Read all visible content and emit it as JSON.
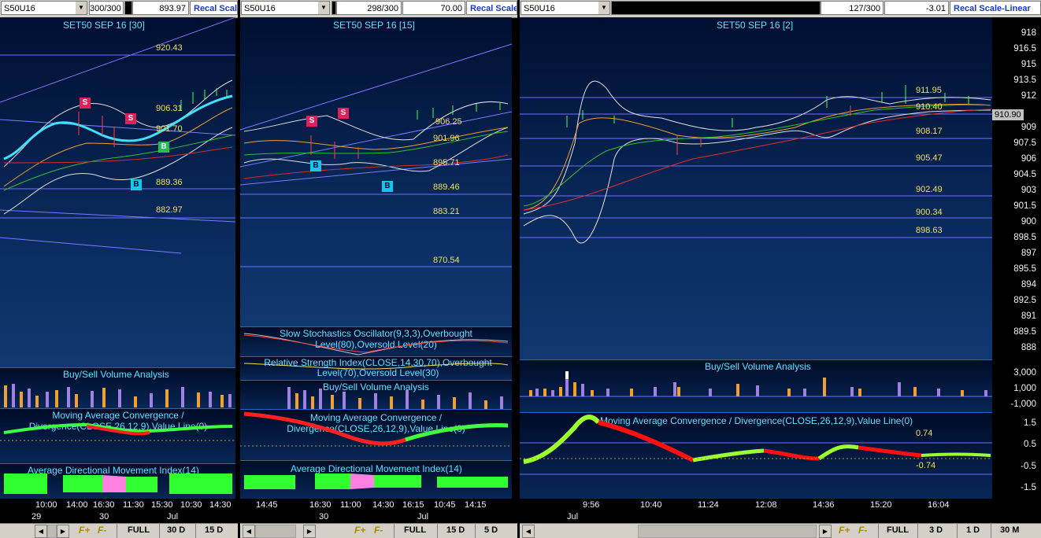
{
  "panes": [
    {
      "symbol": "S50U16",
      "count": "300/300",
      "value": "893.97",
      "recal": "Recal Scal",
      "title": "SET50 SEP 16  [30]",
      "levels": [
        "920.43",
        "906.31",
        "901.70",
        "889.36",
        "882.97"
      ],
      "buy_sell": "Buy/Sell Volume Analysis",
      "macd": "Moving Average Convergence / Divergence(CLOSE,26,12,9),Value Line(0)",
      "adx": "Average Directional Movement Index(14)",
      "times": [
        "10:00",
        "14:00",
        "16:30",
        "11:30",
        "15:30",
        "10:30",
        "14:30"
      ],
      "dates": [
        "29",
        "30",
        "Jul"
      ],
      "footer": [
        "FULL",
        "30 D",
        "15 D"
      ]
    },
    {
      "symbol": "S50U16",
      "count": "298/300",
      "value": "70.00",
      "recal": "Recal Scale",
      "title": "SET50 SEP 16  [15]",
      "levels": [
        "906.25",
        "901.96",
        "895.71",
        "889.46",
        "883.21",
        "870.54"
      ],
      "stoch": "Slow Stochastics Oscillator(9,3,3),Overbought Level(80),Oversold Level(20)",
      "rsi": "Relative Strength Index(CLOSE,14,30,70),Overbought Level(70),Oversold Level(30)",
      "buy_sell": "Buy/Sell Volume Analysis",
      "macd": "Moving Average Convergence / Divergence(CLOSE,26,12,9),Value Line(0)",
      "adx": "Average Directional Movement Index(14)",
      "times": [
        "14:45",
        "16:30",
        "11:00",
        "14:30",
        "16:15",
        "10:45",
        "14:15"
      ],
      "dates": [
        "30",
        "Jul"
      ],
      "footer": [
        "FULL",
        "15 D",
        "5 D"
      ]
    },
    {
      "symbol": "S50U16",
      "count": "127/300",
      "value": "-3.01",
      "recal": "Recal Scale-Linear",
      "title": "SET50 SEP 16  [2]",
      "levels": [
        "911.95",
        "910.40",
        "908.17",
        "905.47",
        "902.49",
        "900.34",
        "898.63"
      ],
      "last": "910.90",
      "yticks": [
        "918",
        "916.5",
        "915",
        "913.5",
        "912",
        "910.5",
        "909",
        "907.5",
        "906",
        "904.5",
        "903",
        "901.5",
        "900",
        "898.5",
        "897",
        "895.5",
        "894",
        "892.5",
        "891",
        "889.5",
        "888"
      ],
      "buy_sell": "Buy/Sell Volume Analysis",
      "vol_ticks": [
        "3,000",
        "1,000",
        "-1,000"
      ],
      "macd": "Moving Average Convergence / Divergence(CLOSE,26,12,9),Value Line(0)",
      "macd_levels": [
        "0.74",
        "-0.74"
      ],
      "macd_ticks": [
        "1.5",
        "0.5",
        "-0.5",
        "-1.5"
      ],
      "times": [
        "9:56",
        "10:40",
        "11:24",
        "12:08",
        "14:36",
        "15:20",
        "16:04"
      ],
      "dates": [
        "Jul"
      ],
      "footer": [
        "FULL",
        "3 D",
        "1 D",
        "30 M"
      ]
    }
  ],
  "footer_icons": [
    "F+",
    "F-"
  ]
}
